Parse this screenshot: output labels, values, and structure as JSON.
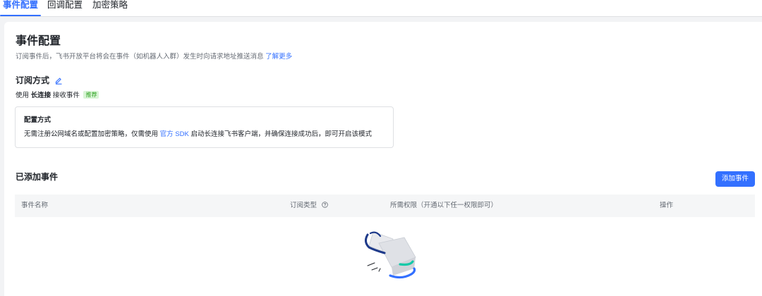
{
  "tabs": [
    {
      "label": "事件配置",
      "active": true
    },
    {
      "label": "回调配置",
      "active": false
    },
    {
      "label": "加密策略",
      "active": false
    }
  ],
  "header": {
    "title": "事件配置",
    "description": "订阅事件后，飞书开放平台将会在事件（如机器人入群）发生时向请求地址推送消息",
    "learn_more": "了解更多"
  },
  "subscription": {
    "title": "订阅方式",
    "edit_icon": "edit-pencil-icon",
    "line_prefix": "使用",
    "line_bold": "长连接",
    "line_suffix": "接收事件",
    "badge": "推荐"
  },
  "mode_box": {
    "title": "配置方式",
    "desc_prefix": "无需注册公网域名或配置加密策略，仅需使用",
    "desc_link": "官方 SDK",
    "desc_suffix": "启动长连接飞书客户端，并确保连接成功后，即可开启该模式"
  },
  "events": {
    "title": "已添加事件",
    "add_button": "添加事件",
    "columns": [
      {
        "label": "事件名称"
      },
      {
        "label": "订阅类型",
        "help_icon": "question-circle-icon"
      },
      {
        "label": "所需权限（开通以下任一权限即可）"
      },
      {
        "label": "操作"
      }
    ],
    "rows": [],
    "empty_illustration": "empty-box-icon"
  },
  "colors": {
    "accent": "#3370ff",
    "badge_bg": "#d9f5d6",
    "badge_text": "#2ea121",
    "page_bg": "#f2f3f5",
    "text_primary": "#1f2329",
    "text_secondary": "#646a73"
  }
}
